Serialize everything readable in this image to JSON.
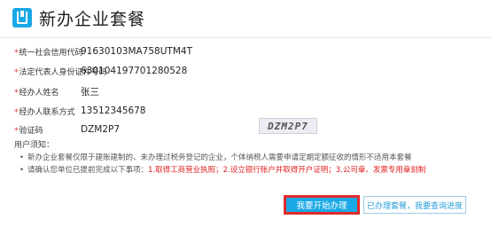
{
  "header": {
    "title": "新办企业套餐"
  },
  "form": {
    "fields": [
      {
        "label": "统一社会信用代码",
        "value": "91630103MA758UTM4T"
      },
      {
        "label": "法定代表人身份证件号码",
        "value": "630104197701280528"
      },
      {
        "label": "经办人姓名",
        "value": "张三"
      },
      {
        "label": "经办人联系方式",
        "value": "13512345678"
      },
      {
        "label": "验证码",
        "value": "DZM2P7"
      }
    ],
    "captcha_text": "DZM2P7"
  },
  "notice": {
    "title": "用户须知：",
    "line1": "新办企业套餐仅限于建账建制的、未办理过税务登记的企业，个体纳税人需要申请定期定额征收的情形不适用本套餐",
    "line2_prefix": "请确认您单位已提前完成以下事项：",
    "line2_items": "1.取得工商营业执照；2.设立银行账户并取得开户证明；3.公司章、发票专用章刻制"
  },
  "buttons": {
    "primary": "我要开始办理",
    "secondary": "已办理套餐，我要查询进度"
  },
  "colors": {
    "accent": "#1aa8e6",
    "highlight": "#e22a2a",
    "required": "#e03030"
  }
}
